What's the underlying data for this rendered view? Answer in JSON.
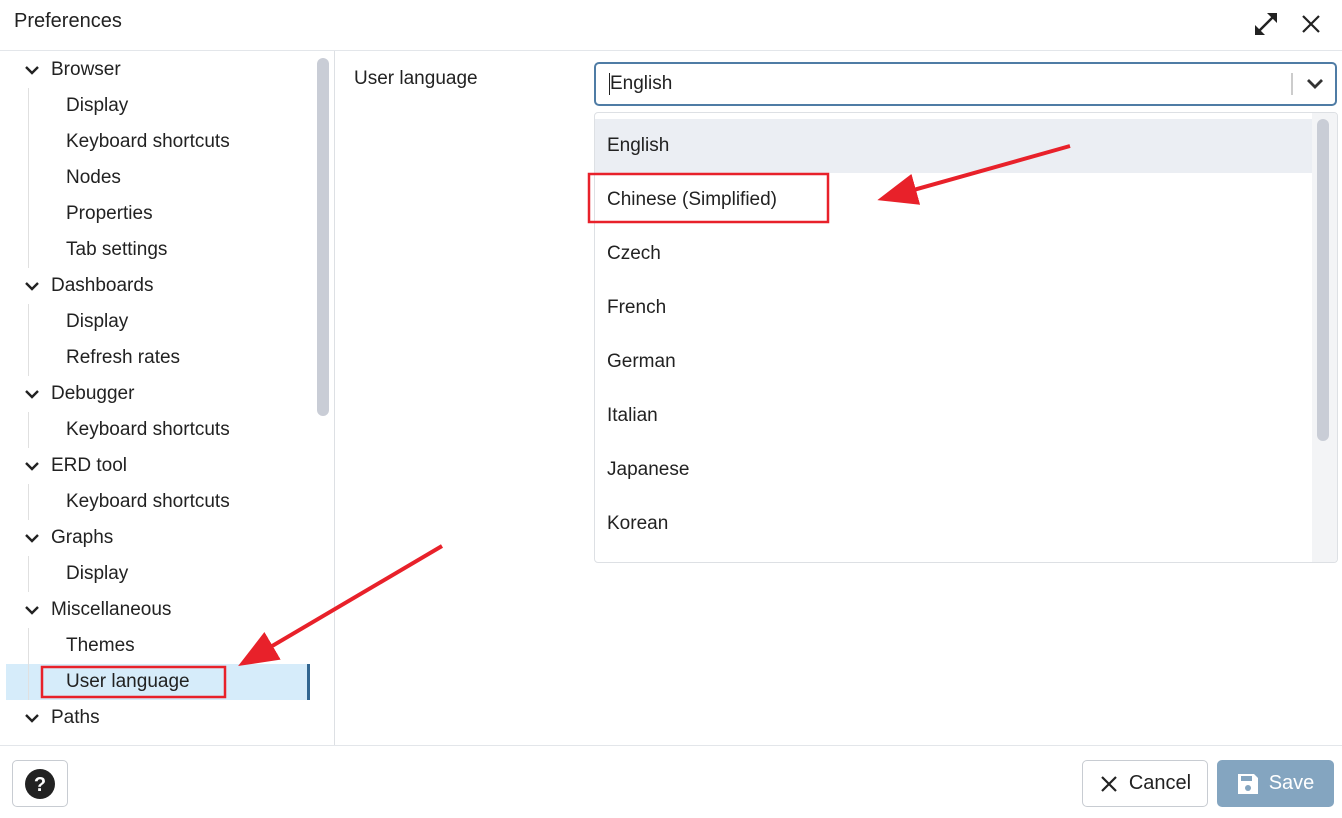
{
  "dialog": {
    "title": "Preferences"
  },
  "header": {
    "maximize_icon": "expand-arrows-icon",
    "close_icon": "close-icon"
  },
  "tree": [
    {
      "label": "Browser",
      "level": 0
    },
    {
      "label": "Display",
      "level": 1
    },
    {
      "label": "Keyboard shortcuts",
      "level": 1
    },
    {
      "label": "Nodes",
      "level": 1
    },
    {
      "label": "Properties",
      "level": 1
    },
    {
      "label": "Tab settings",
      "level": 1
    },
    {
      "label": "Dashboards",
      "level": 0
    },
    {
      "label": "Display",
      "level": 1
    },
    {
      "label": "Refresh rates",
      "level": 1
    },
    {
      "label": "Debugger",
      "level": 0
    },
    {
      "label": "Keyboard shortcuts",
      "level": 1
    },
    {
      "label": "ERD tool",
      "level": 0
    },
    {
      "label": "Keyboard shortcuts",
      "level": 1
    },
    {
      "label": "Graphs",
      "level": 0
    },
    {
      "label": "Display",
      "level": 1
    },
    {
      "label": "Miscellaneous",
      "level": 0
    },
    {
      "label": "Themes",
      "level": 1
    },
    {
      "label": "User language",
      "level": 1,
      "selected": true
    },
    {
      "label": "Paths",
      "level": 0
    }
  ],
  "main": {
    "field_label": "User language",
    "select_value": "English",
    "options": [
      "English",
      "Chinese (Simplified)",
      "Czech",
      "French",
      "German",
      "Italian",
      "Japanese",
      "Korean"
    ],
    "highlighted_option": "English"
  },
  "footer": {
    "help_icon": "question-circle-icon",
    "cancel_label": "Cancel",
    "save_label": "Save"
  },
  "colors": {
    "accent": "#326690",
    "selected_bg": "#d6ecfa",
    "save_bg": "#84a5c0",
    "annotation": "#e8212a"
  }
}
